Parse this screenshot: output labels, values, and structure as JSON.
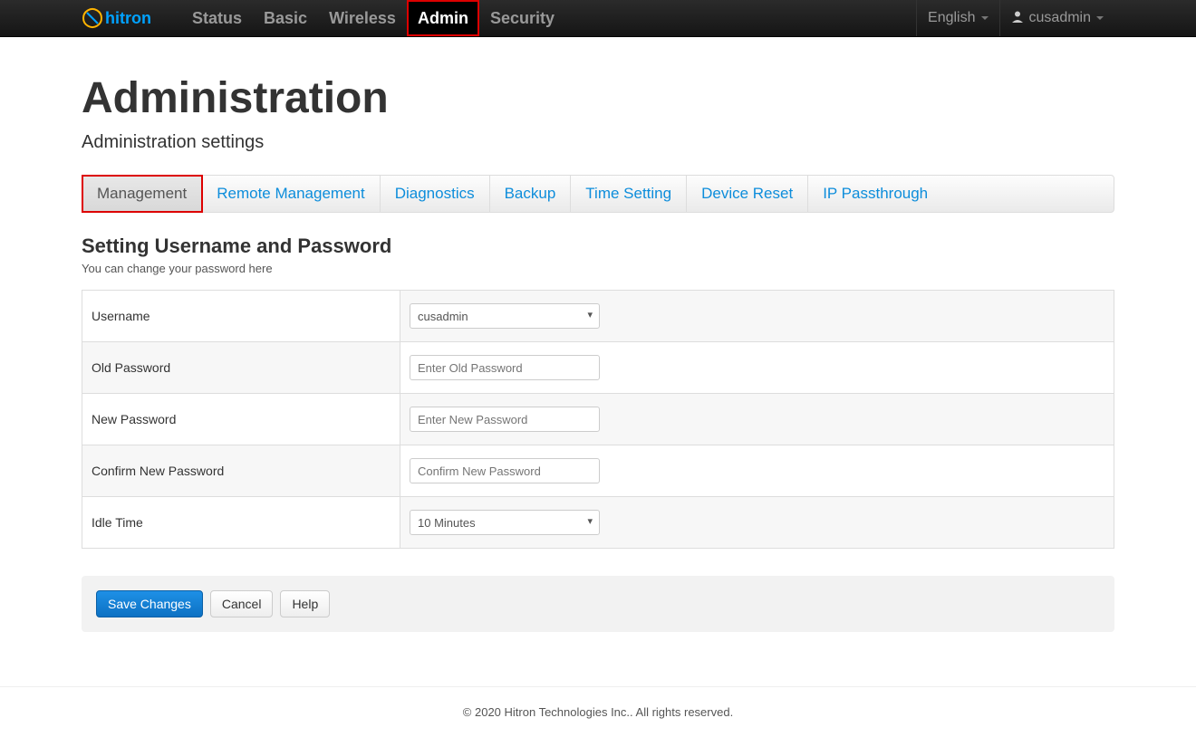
{
  "navbar": {
    "brand": "hitron",
    "items": [
      {
        "label": "Status",
        "active": false,
        "highlight": false
      },
      {
        "label": "Basic",
        "active": false,
        "highlight": false
      },
      {
        "label": "Wireless",
        "active": false,
        "highlight": false
      },
      {
        "label": "Admin",
        "active": true,
        "highlight": true
      },
      {
        "label": "Security",
        "active": false,
        "highlight": false
      }
    ],
    "language": "English",
    "username": "cusadmin"
  },
  "page": {
    "title": "Administration",
    "subtitle": "Administration settings"
  },
  "tabs": [
    {
      "label": "Management",
      "active": true,
      "highlight": true
    },
    {
      "label": "Remote Management",
      "active": false,
      "highlight": false
    },
    {
      "label": "Diagnostics",
      "active": false,
      "highlight": false
    },
    {
      "label": "Backup",
      "active": false,
      "highlight": false
    },
    {
      "label": "Time Setting",
      "active": false,
      "highlight": false
    },
    {
      "label": "Device Reset",
      "active": false,
      "highlight": false
    },
    {
      "label": "IP Passthrough",
      "active": false,
      "highlight": false
    }
  ],
  "section": {
    "title": "Setting Username and Password",
    "desc": "You can change your password here"
  },
  "form": {
    "username_label": "Username",
    "username_value": "cusadmin",
    "old_password_label": "Old Password",
    "old_password_placeholder": "Enter Old Password",
    "new_password_label": "New Password",
    "new_password_placeholder": "Enter New Password",
    "confirm_password_label": "Confirm New Password",
    "confirm_password_placeholder": "Confirm New Password",
    "idle_time_label": "Idle Time",
    "idle_time_value": "10 Minutes"
  },
  "buttons": {
    "save": "Save Changes",
    "cancel": "Cancel",
    "help": "Help"
  },
  "footer": "© 2020 Hitron Technologies Inc.. All rights reserved."
}
